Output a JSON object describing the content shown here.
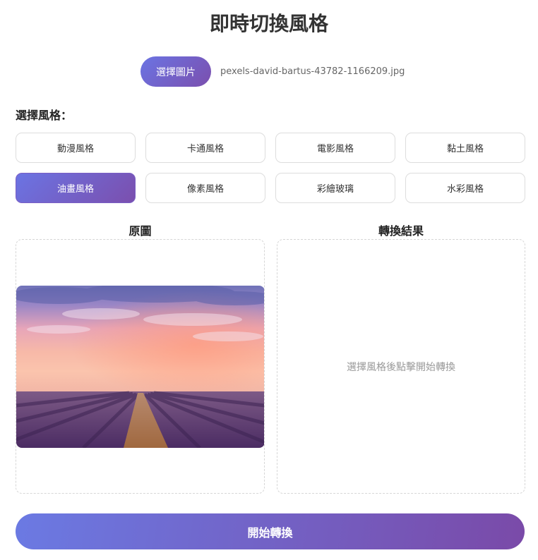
{
  "app": {
    "title": "即時切換風格"
  },
  "upload": {
    "button_label": "選擇圖片",
    "file_name": "pexels-david-bartus-43782-1166209.jpg"
  },
  "styles": {
    "heading": "選擇風格：",
    "items": [
      {
        "label": "動漫風格",
        "active": false
      },
      {
        "label": "卡通風格",
        "active": false
      },
      {
        "label": "電影風格",
        "active": false
      },
      {
        "label": "黏土風格",
        "active": false
      },
      {
        "label": "油畫風格",
        "active": true
      },
      {
        "label": "像素風格",
        "active": false
      },
      {
        "label": "彩繪玻璃",
        "active": false
      },
      {
        "label": "水彩風格",
        "active": false
      }
    ]
  },
  "panels": {
    "original_title": "原圖",
    "result_title": "轉換結果",
    "result_placeholder": "選擇風格後點擊開始轉換"
  },
  "actions": {
    "start_label": "開始轉換"
  },
  "colors": {
    "accent_start": "#6b74e3",
    "accent_end": "#7b4fae",
    "border": "#dddddd"
  }
}
